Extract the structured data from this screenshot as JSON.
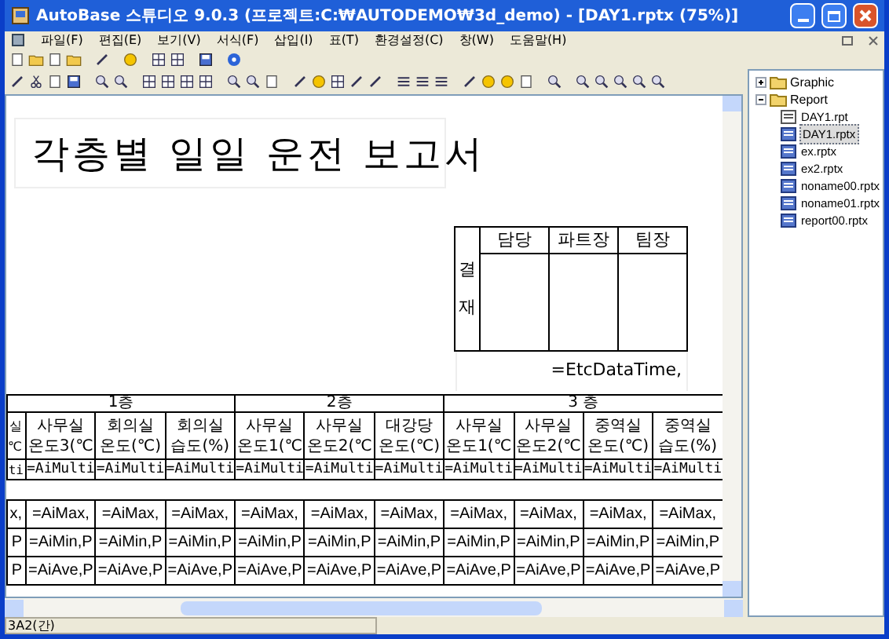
{
  "window": {
    "title": "AutoBase 스튜디오 9.0.3 (프로젝트:C:₩AUTODEMO₩3d_demo) - [DAY1.rptx (75%)]"
  },
  "menu": [
    "파일(F)",
    "편집(E)",
    "보기(V)",
    "서식(F)",
    "삽입(I)",
    "표(T)",
    "환경설정(C)",
    "창(W)",
    "도움말(H)"
  ],
  "report": {
    "title": "각층별 일일 운전 보고서",
    "approval": {
      "label": "결재",
      "headers": [
        "담당",
        "파트장",
        "팀장"
      ]
    },
    "datetime": "=EtcDataTime,",
    "table": {
      "floors": [
        {
          "label": "1층"
        },
        {
          "label": "2층"
        },
        {
          "label": "3 층"
        }
      ],
      "columns": [
        {
          "line1": "실",
          "line2": "℃"
        },
        {
          "line1": "사무실",
          "line2": "온도3(℃"
        },
        {
          "line1": "회의실",
          "line2": "온도(℃)"
        },
        {
          "line1": "회의실",
          "line2": "습도(%)"
        },
        {
          "line1": "사무실",
          "line2": "온도1(℃"
        },
        {
          "line1": "사무실",
          "line2": "온도2(℃"
        },
        {
          "line1": "대강당",
          "line2": "온도(℃)"
        },
        {
          "line1": "사무실",
          "line2": "온도1(℃"
        },
        {
          "line1": "사무실",
          "line2": "온도2(℃"
        },
        {
          "line1": "중역실",
          "line2": "온도(℃)"
        },
        {
          "line1": "중역실",
          "line2": "습도(%)"
        }
      ],
      "multi_row": [
        "ti",
        "=AiMulti",
        "=AiMulti",
        "=AiMulti",
        "=AiMulti",
        "=AiMulti",
        "=AiMulti",
        "=AiMulti",
        "=AiMulti",
        "=AiMulti",
        "=AiMulti"
      ],
      "summary_rows": [
        [
          "x,",
          "=AiMax,",
          "=AiMax,",
          "=AiMax,",
          "=AiMax,",
          "=AiMax,",
          "=AiMax,",
          "=AiMax,",
          "=AiMax,",
          "=AiMax,",
          "=AiMax,"
        ],
        [
          "P",
          "=AiMin,P",
          "=AiMin,P",
          "=AiMin,P",
          "=AiMin,P",
          "=AiMin,P",
          "=AiMin,P",
          "=AiMin,P",
          "=AiMin,P",
          "=AiMin,P",
          "=AiMin,P"
        ],
        [
          "P",
          "=AiAve,P",
          "=AiAve,P",
          "=AiAve,P",
          "=AiAve,P",
          "=AiAve,P",
          "=AiAve,P",
          "=AiAve,P",
          "=AiAve,P",
          "=AiAve,P",
          "=AiAve,P"
        ]
      ]
    }
  },
  "tree": [
    {
      "label": "Graphic",
      "expanded": false
    },
    {
      "label": "Report",
      "expanded": true,
      "children": [
        {
          "label": "DAY1.rpt",
          "kind": "rpt",
          "selected": false
        },
        {
          "label": "DAY1.rptx",
          "kind": "rptx",
          "selected": true
        },
        {
          "label": "ex.rptx",
          "kind": "rptx",
          "selected": false
        },
        {
          "label": "ex2.rptx",
          "kind": "rptx",
          "selected": false
        },
        {
          "label": "noname00.rptx",
          "kind": "rptx",
          "selected": false
        },
        {
          "label": "noname01.rptx",
          "kind": "rptx",
          "selected": false
        },
        {
          "label": "report00.rptx",
          "kind": "rptx",
          "selected": false
        }
      ]
    }
  ],
  "status_bar": {
    "text": "3A2(간)"
  }
}
